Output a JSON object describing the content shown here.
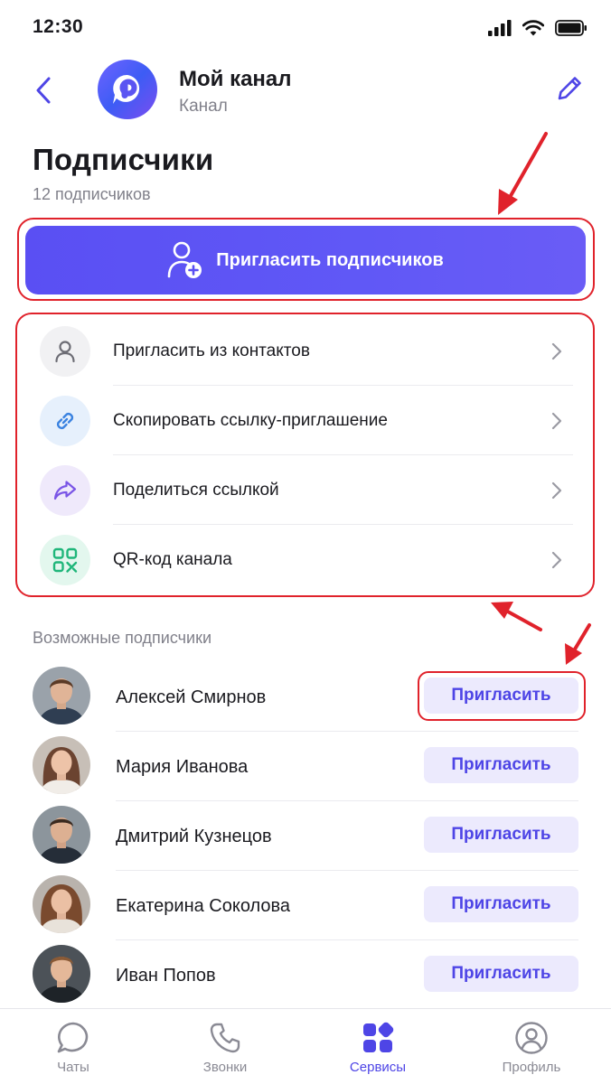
{
  "status_bar": {
    "time": "12:30"
  },
  "header": {
    "channel_name": "Мой канал",
    "channel_type": "Канал"
  },
  "page": {
    "title": "Подписчики",
    "subscriber_count": "12 подписчиков"
  },
  "primary_action": {
    "label": "Пригласить подписчиков",
    "icon": "add-user-icon"
  },
  "options": [
    {
      "label": "Пригласить из контактов",
      "icon": "person-icon",
      "icon_bg": "#f1f1f3",
      "icon_color": "#6c6c74"
    },
    {
      "label": "Скопировать ссылку-приглашение",
      "icon": "link-icon",
      "icon_bg": "#e6f0fc",
      "icon_color": "#3a82e0"
    },
    {
      "label": "Поделиться ссылкой",
      "icon": "share-icon",
      "icon_bg": "#efe9fb",
      "icon_color": "#7a55e6"
    },
    {
      "label": "QR-код канала",
      "icon": "qr-code-icon",
      "icon_bg": "#e3f7ee",
      "icon_color": "#1fb67a"
    }
  ],
  "suggestions": {
    "title": "Возможные подписчики",
    "invite_label": "Пригласить",
    "people": [
      {
        "name": "Алексей Смирнов"
      },
      {
        "name": "Мария Иванова"
      },
      {
        "name": "Дмитрий Кузнецов"
      },
      {
        "name": "Екатерина Соколова"
      },
      {
        "name": "Иван Попов"
      }
    ]
  },
  "tabs": [
    {
      "label": "Чаты",
      "icon": "chat-icon",
      "active": false
    },
    {
      "label": "Звонки",
      "icon": "phone-icon",
      "active": false
    },
    {
      "label": "Сервисы",
      "icon": "services-icon",
      "active": true
    },
    {
      "label": "Профиль",
      "icon": "profile-icon",
      "active": false
    }
  ],
  "colors": {
    "accent": "#5a4ff3",
    "annotation": "#e0222b",
    "invite_bg": "#eceafd"
  }
}
